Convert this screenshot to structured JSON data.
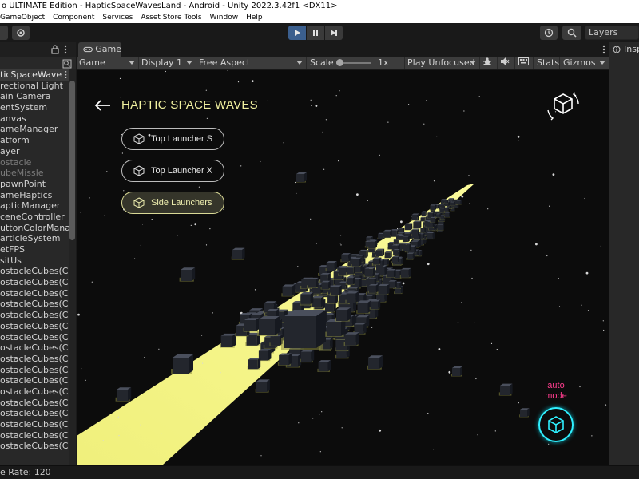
{
  "window": {
    "title": "o ULTIMATE Edition - HapticSpaceWavesLand - Android - Unity 2022.3.42f1 <DX11>"
  },
  "menu": [
    "GameObject",
    "Component",
    "Services",
    "Asset Store Tools",
    "Window",
    "Help"
  ],
  "toolbar": {
    "layers_label": "Layers"
  },
  "hierarchy": {
    "scene_name": "ticSpaceWave",
    "items": [
      {
        "label": "rectional Light",
        "dim": false
      },
      {
        "label": "ain Camera",
        "dim": false
      },
      {
        "label": "entSystem",
        "dim": false
      },
      {
        "label": "anvas",
        "dim": false
      },
      {
        "label": "ameManager",
        "dim": false
      },
      {
        "label": "atform",
        "dim": false
      },
      {
        "label": "ayer",
        "dim": false
      },
      {
        "label": "ostacle",
        "dim": true
      },
      {
        "label": "ubeMissle",
        "dim": true
      },
      {
        "label": "pawnPoint",
        "dim": false
      },
      {
        "label": "ameHaptics",
        "dim": false
      },
      {
        "label": "apticManager",
        "dim": false
      },
      {
        "label": "ceneController",
        "dim": false
      },
      {
        "label": "uttonColorManage",
        "dim": false
      },
      {
        "label": "articleSystem",
        "dim": false
      },
      {
        "label": "etFPS",
        "dim": false
      },
      {
        "label": "sitUs",
        "dim": false
      },
      {
        "label": "ostacleCubes(Clon",
        "dim": false
      },
      {
        "label": "ostacleCubes(Clon",
        "dim": false
      },
      {
        "label": "ostacleCubes(Clon",
        "dim": false
      },
      {
        "label": "ostacleCubes(Clon",
        "dim": false
      },
      {
        "label": "ostacleCubes(Clon",
        "dim": false
      },
      {
        "label": "ostacleCubes(Clon",
        "dim": false
      },
      {
        "label": "ostacleCubes(Clon",
        "dim": false
      },
      {
        "label": "ostacleCubes(Clon",
        "dim": false
      },
      {
        "label": "ostacleCubes(Clon",
        "dim": false
      },
      {
        "label": "ostacleCubes(Clon",
        "dim": false
      },
      {
        "label": "ostacleCubes(Clon",
        "dim": false
      },
      {
        "label": "ostacleCubes(Clon",
        "dim": false
      },
      {
        "label": "ostacleCubes(Clon",
        "dim": false
      },
      {
        "label": "ostacleCubes(Clon",
        "dim": false
      },
      {
        "label": "ostacleCubes(Clon",
        "dim": false
      },
      {
        "label": "ostacleCubes(Clon",
        "dim": false
      },
      {
        "label": "ostacleCubes(Clon",
        "dim": false
      }
    ]
  },
  "game_panel": {
    "tab_label": "Game",
    "mode_dropdown": "Game",
    "display_dropdown": "Display 1",
    "aspect_dropdown": "Free Aspect",
    "scale_label": "Scale",
    "scale_value": "1x",
    "play_focus_dropdown": "Play Unfocused",
    "stats_label": "Stats",
    "gizmos_label": "Gizmos"
  },
  "game_ui": {
    "title": "HAPTIC SPACE WAVES",
    "buttons": [
      {
        "label": "Top Launcher S",
        "active": false
      },
      {
        "label": "Top Launcher X",
        "active": false
      },
      {
        "label": "Side Launchers",
        "active": true
      }
    ],
    "auto_mode_label": "auto\nmode",
    "colors": {
      "title": "#f2f2a0",
      "track": "#f5f58a",
      "auto_mode_text": "#ff3d8e",
      "auto_button_ring": "#2ff0ff"
    }
  },
  "inspector": {
    "tab_label": "Insp"
  },
  "status": {
    "text": "e Rate: 120"
  }
}
